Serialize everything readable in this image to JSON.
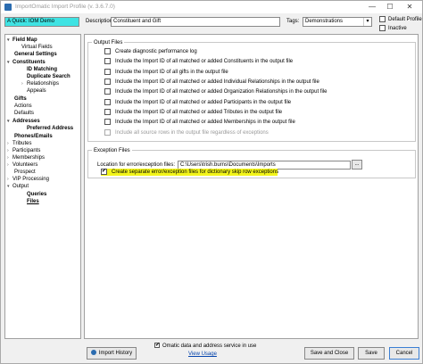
{
  "window": {
    "title": "ImportOmatic Import Profile (v. 3.6.7.0)",
    "controls": [
      "—",
      "☐",
      "✕"
    ]
  },
  "header": {
    "profile_name": "A Quick: IOM Demo",
    "description_label": "Description:",
    "description_value": "Constituent and Gift",
    "tags_label": "Tags:",
    "tags_value": "Demonstrations",
    "default_profile_label": "Default Profile",
    "inactive_label": "Inactive"
  },
  "nav": {
    "items": [
      {
        "label": "Field Map",
        "bold": true,
        "arrow": "▾"
      },
      {
        "label": "Virtual Fields"
      },
      {
        "label": "General Settings",
        "bold": true
      },
      {
        "label": "Constituents",
        "bold": true,
        "arrow": "▾"
      },
      {
        "label": "ID Matching",
        "bold": true
      },
      {
        "label": "Duplicate Search",
        "bold": true
      },
      {
        "label": "Relationships",
        "arrow": "›"
      },
      {
        "label": "Appeals"
      },
      {
        "label": "Gifts",
        "bold": true
      },
      {
        "label": "Actions"
      },
      {
        "label": "Defaults"
      },
      {
        "label": "Addresses",
        "bold": true,
        "arrow": "▾"
      },
      {
        "label": "Preferred Address",
        "bold": true
      },
      {
        "label": "Phones/Emails",
        "bold": true
      },
      {
        "label": "Tributes",
        "arrow": "›"
      },
      {
        "label": "Participants",
        "arrow": "›"
      },
      {
        "label": "Memberships",
        "arrow": "›"
      },
      {
        "label": "Volunteers",
        "arrow": "›"
      },
      {
        "label": "Prospect"
      },
      {
        "label": "VIP Processing",
        "arrow": "›"
      },
      {
        "label": "Output",
        "arrow": "▾"
      },
      {
        "label": "Queries",
        "bold": true
      },
      {
        "label": "Files",
        "bold": true
      }
    ]
  },
  "output_files": {
    "title": "Output Files",
    "options": [
      "Create diagnostic performance log",
      "Include the Import ID of all matched or added Constituents in the output file",
      "Include the Import ID of all gifts in the output file",
      "Include the Import ID of all matched or added Individual Relationships in the output file",
      "Include the Import ID of all matched or added Organization Relationships in the output file",
      "Include the Import ID of all matched or added Participants in the output file",
      "Include the Import ID of all matched or added Tributes in the output file",
      "Include the Import ID of all matched or added Memberships in the output file",
      "Include all source rows in the output file regardless of exceptions"
    ]
  },
  "exception_files": {
    "title": "Exception Files",
    "location_label": "Location for error/exception files:",
    "location_value": "C:\\Users\\trish.burns\\Documents\\Imports",
    "browse_label": "...",
    "separate_files_label": "Create separate error/exception files for dictionary skip row exceptions"
  },
  "footer": {
    "import_history": "Import History",
    "omatic_service": "Omatic data and address service in use",
    "view_usage": "View Usage",
    "save_close": "Save and Close",
    "save": "Save",
    "cancel": "Cancel"
  }
}
